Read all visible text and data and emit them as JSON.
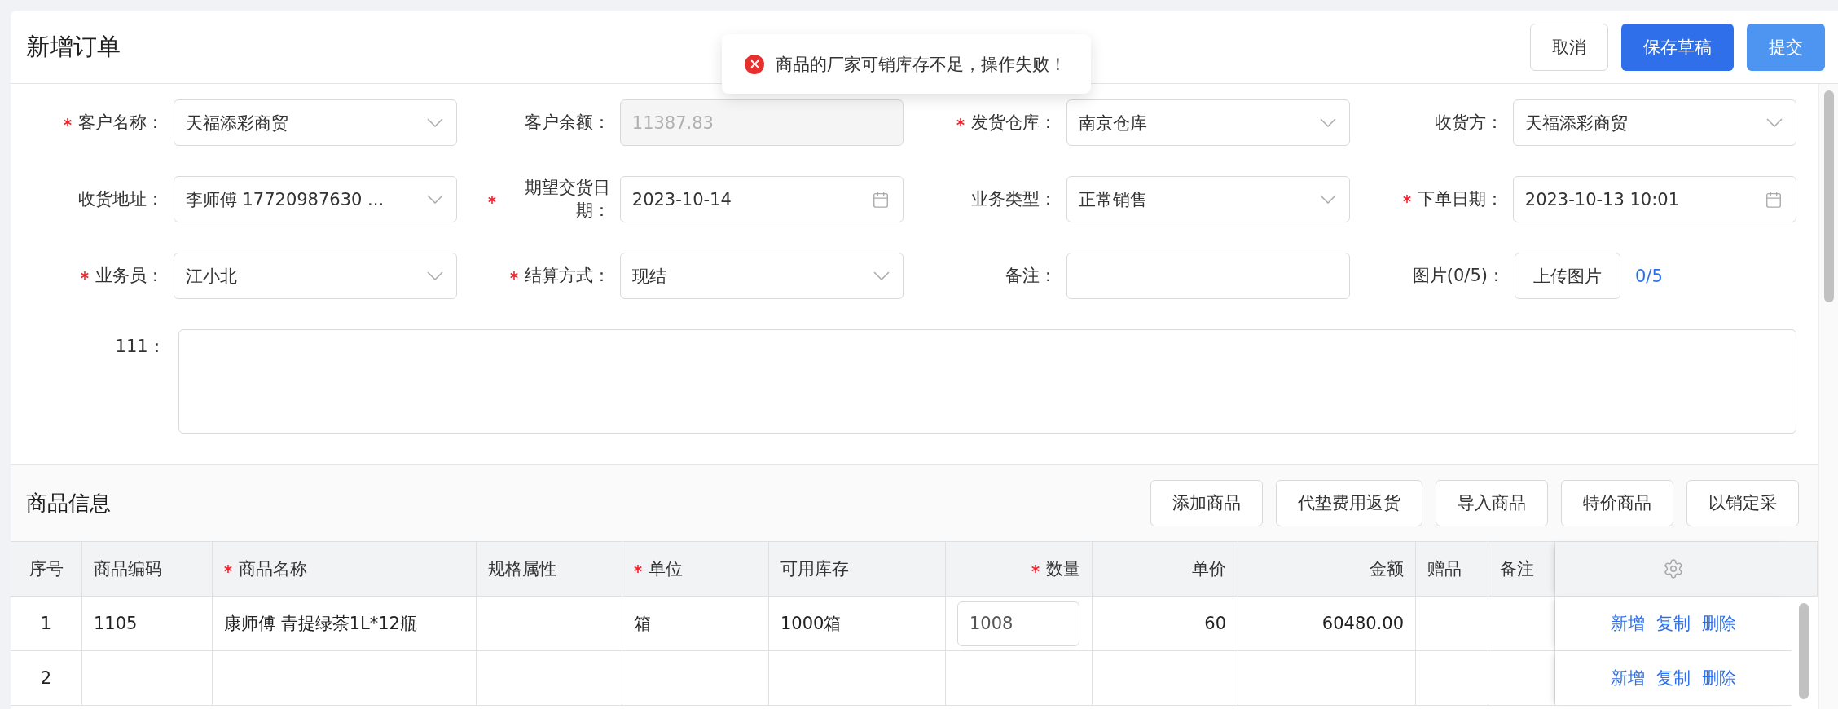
{
  "header": {
    "title": "新增订单",
    "buttons": [
      {
        "label": "取消",
        "kind": "default"
      },
      {
        "label": "保存草稿",
        "kind": "primary"
      },
      {
        "label": "提交",
        "kind": "light"
      }
    ]
  },
  "toast": {
    "kind": "error",
    "message": "商品的厂家可销库存不足，操作失败！"
  },
  "form": {
    "fields": [
      {
        "label": "客户名称：",
        "required": true,
        "kind": "select",
        "value": "天福添彩商贸"
      },
      {
        "label": "客户余额：",
        "required": false,
        "kind": "readonly",
        "value": "11387.83"
      },
      {
        "label": "发货仓库：",
        "required": true,
        "kind": "select",
        "value": "南京仓库"
      },
      {
        "label": "收货方：",
        "required": false,
        "kind": "select",
        "value": "天福添彩商贸"
      },
      {
        "label": "收货地址：",
        "required": false,
        "kind": "select",
        "value": "李师傅 17720987630 ..."
      },
      {
        "label": "期望交货日期：",
        "required": true,
        "kind": "date",
        "value": "2023-10-14"
      },
      {
        "label": "业务类型：",
        "required": false,
        "kind": "select",
        "value": "正常销售"
      },
      {
        "label": "下单日期：",
        "required": true,
        "kind": "date",
        "value": "2023-10-13 10:01"
      },
      {
        "label": "业务员：",
        "required": true,
        "kind": "select",
        "value": "江小北"
      },
      {
        "label": "结算方式：",
        "required": true,
        "kind": "select",
        "value": "现结"
      },
      {
        "label": "备注：",
        "required": false,
        "kind": "text"
      },
      {
        "label": "图片(0/5)：",
        "required": false,
        "kind": "upload",
        "button": "上传图片",
        "count": "0/5"
      }
    ],
    "textarea": {
      "label": "111："
    }
  },
  "products": {
    "title": "商品信息",
    "buttons": [
      "添加商品",
      "代垫费用返货",
      "导入商品",
      "特价商品",
      "以销定采"
    ],
    "columns": [
      {
        "label": "序号",
        "required": false
      },
      {
        "label": "商品编码",
        "required": false
      },
      {
        "label": "商品名称",
        "required": true
      },
      {
        "label": "规格属性",
        "required": false
      },
      {
        "label": "单位",
        "required": true
      },
      {
        "label": "可用库存",
        "required": false
      },
      {
        "label": "数量",
        "required": true
      },
      {
        "label": "单价",
        "required": false
      },
      {
        "label": "金额",
        "required": false
      },
      {
        "label": "赠品",
        "required": false
      },
      {
        "label": "备注",
        "required": false
      }
    ],
    "rows": [
      {
        "index": "1",
        "code": "1105",
        "name": "康师傅 青提绿茶1L*12瓶",
        "unit": "箱",
        "stock": "1000箱",
        "quantity": "1008",
        "price": "60",
        "amount": "60480.00",
        "actions": [
          "新增",
          "复制",
          "删除"
        ]
      },
      {
        "index": "2",
        "actions": [
          "新增",
          "复制",
          "删除"
        ]
      }
    ]
  }
}
